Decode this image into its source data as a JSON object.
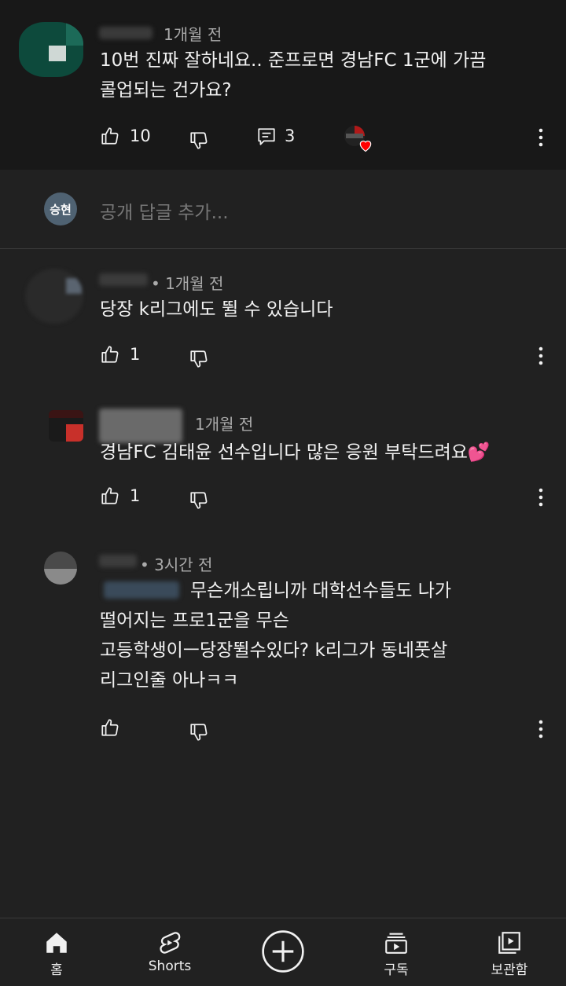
{
  "comments": [
    {
      "time": "1개월 전",
      "text_line1": "10번 진짜 잘하네요.. 준프로면 경남FC 1군에 가끔",
      "text_line2": "콜업되는 건가요?",
      "likes": "10",
      "replies": "3"
    },
    {
      "time": "• 1개월 전",
      "text_line1": "당장 k리그에도 뛸 수 있습니다",
      "likes": "1"
    },
    {
      "time": "1개월 전",
      "text_line1": "경남FC 김태윤 선수입니다 많은 응원 부탁드려요",
      "emoji": "💕",
      "likes": "1"
    },
    {
      "time": "• 3시간 전",
      "text_line1": "무슨개소립니까 대학선수들도 나가",
      "text_line2": "떨어지는 프로1군을 무슨",
      "text_line3": "고등학생이ㅡ당장뛸수있다? k리그가 동네풋살",
      "text_line4": "리그인줄 아나ㅋㅋ"
    }
  ],
  "reply_box": {
    "avatar_initials": "승현",
    "placeholder": "공개 답글 추가..."
  },
  "nav": {
    "home": "홈",
    "shorts": "Shorts",
    "subscriptions": "구독",
    "library": "보관함"
  },
  "colors": {
    "background": "#212121",
    "highlight_background": "#181818",
    "heart": "#ff0000",
    "reply_avatar": "#4f6272"
  },
  "icons": [
    "like-icon",
    "dislike-icon",
    "reply-icon",
    "more-icon",
    "heart-icon",
    "home-icon",
    "shorts-icon",
    "create-icon",
    "subscriptions-icon",
    "library-icon"
  ]
}
